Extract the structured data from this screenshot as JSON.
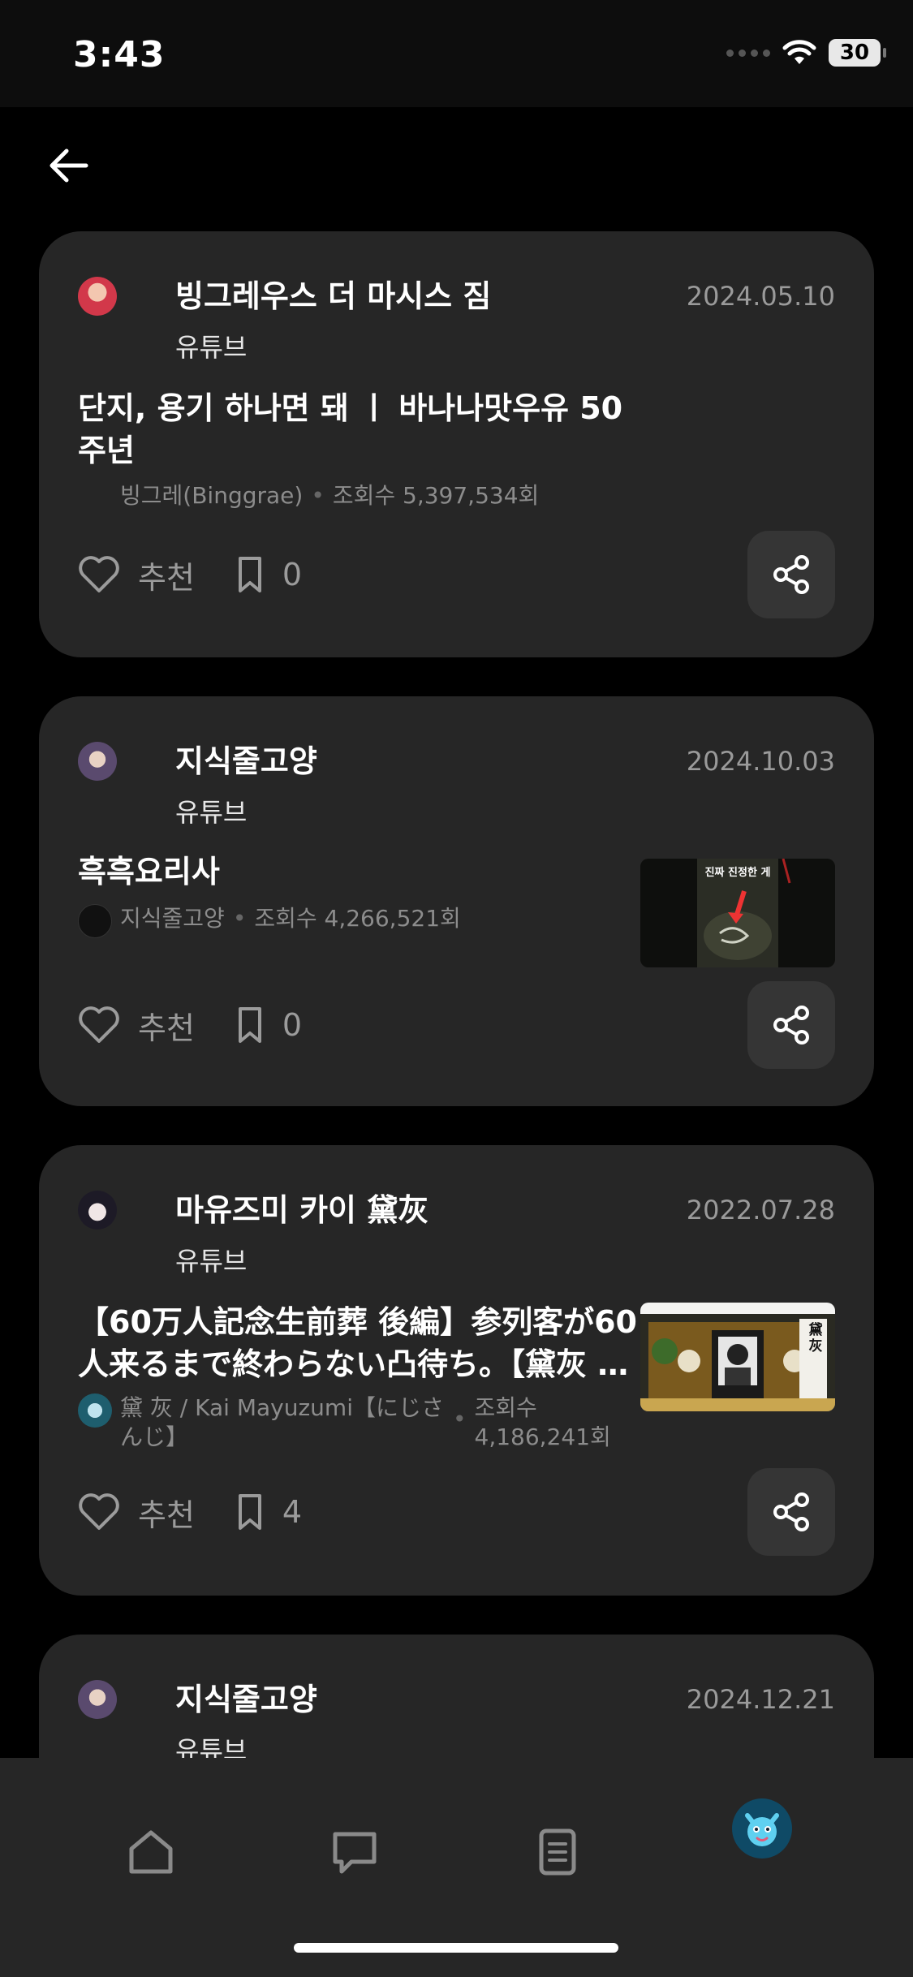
{
  "status_bar": {
    "time": "3:43",
    "battery": "30"
  },
  "posts": [
    {
      "author": "빙그레우스 더 마시스 짐",
      "date": "2024.05.10",
      "source": "유튜브",
      "title": "단지, 용기 하나면 돼 ㅣ 바나나맛우유 50주년",
      "channel": "빙그레(Binggrae)",
      "views": "조회수 5,397,534회",
      "like_label": "추천",
      "bookmark_count": "0",
      "has_thumbnail": false
    },
    {
      "author": "지식줄고양",
      "date": "2024.10.03",
      "source": "유튜브",
      "title": "흑흑요리사",
      "channel": "지식줄고양",
      "views": "조회수 4,266,521회",
      "like_label": "추천",
      "bookmark_count": "0",
      "has_thumbnail": true,
      "thumbnail_caption": "진짜 진정한 게"
    },
    {
      "author": "마유즈미 카이 黛灰",
      "date": "2022.07.28",
      "source": "유튜브",
      "title": "【60万人記念生前葬 後編】参列客が60人来るまで終わらない凸待ち。【黛灰 …",
      "channel": "黛 灰 / Kai Mayuzumi【にじさんじ】",
      "views": "조회수 4,186,241회",
      "like_label": "추천",
      "bookmark_count": "4",
      "has_thumbnail": true,
      "thumbnail_caption": "黛灰"
    },
    {
      "author": "지식줄고양",
      "date": "2024.12.21",
      "source": "유튜브"
    }
  ],
  "tab_bar": {
    "items": [
      "home-icon",
      "chat-bubble-icon",
      "document-icon",
      "profile-avatar"
    ]
  },
  "colors": {
    "background": "#000000",
    "card": "#262626",
    "share_button": "#353535",
    "muted_text": "#9a9a9a"
  }
}
